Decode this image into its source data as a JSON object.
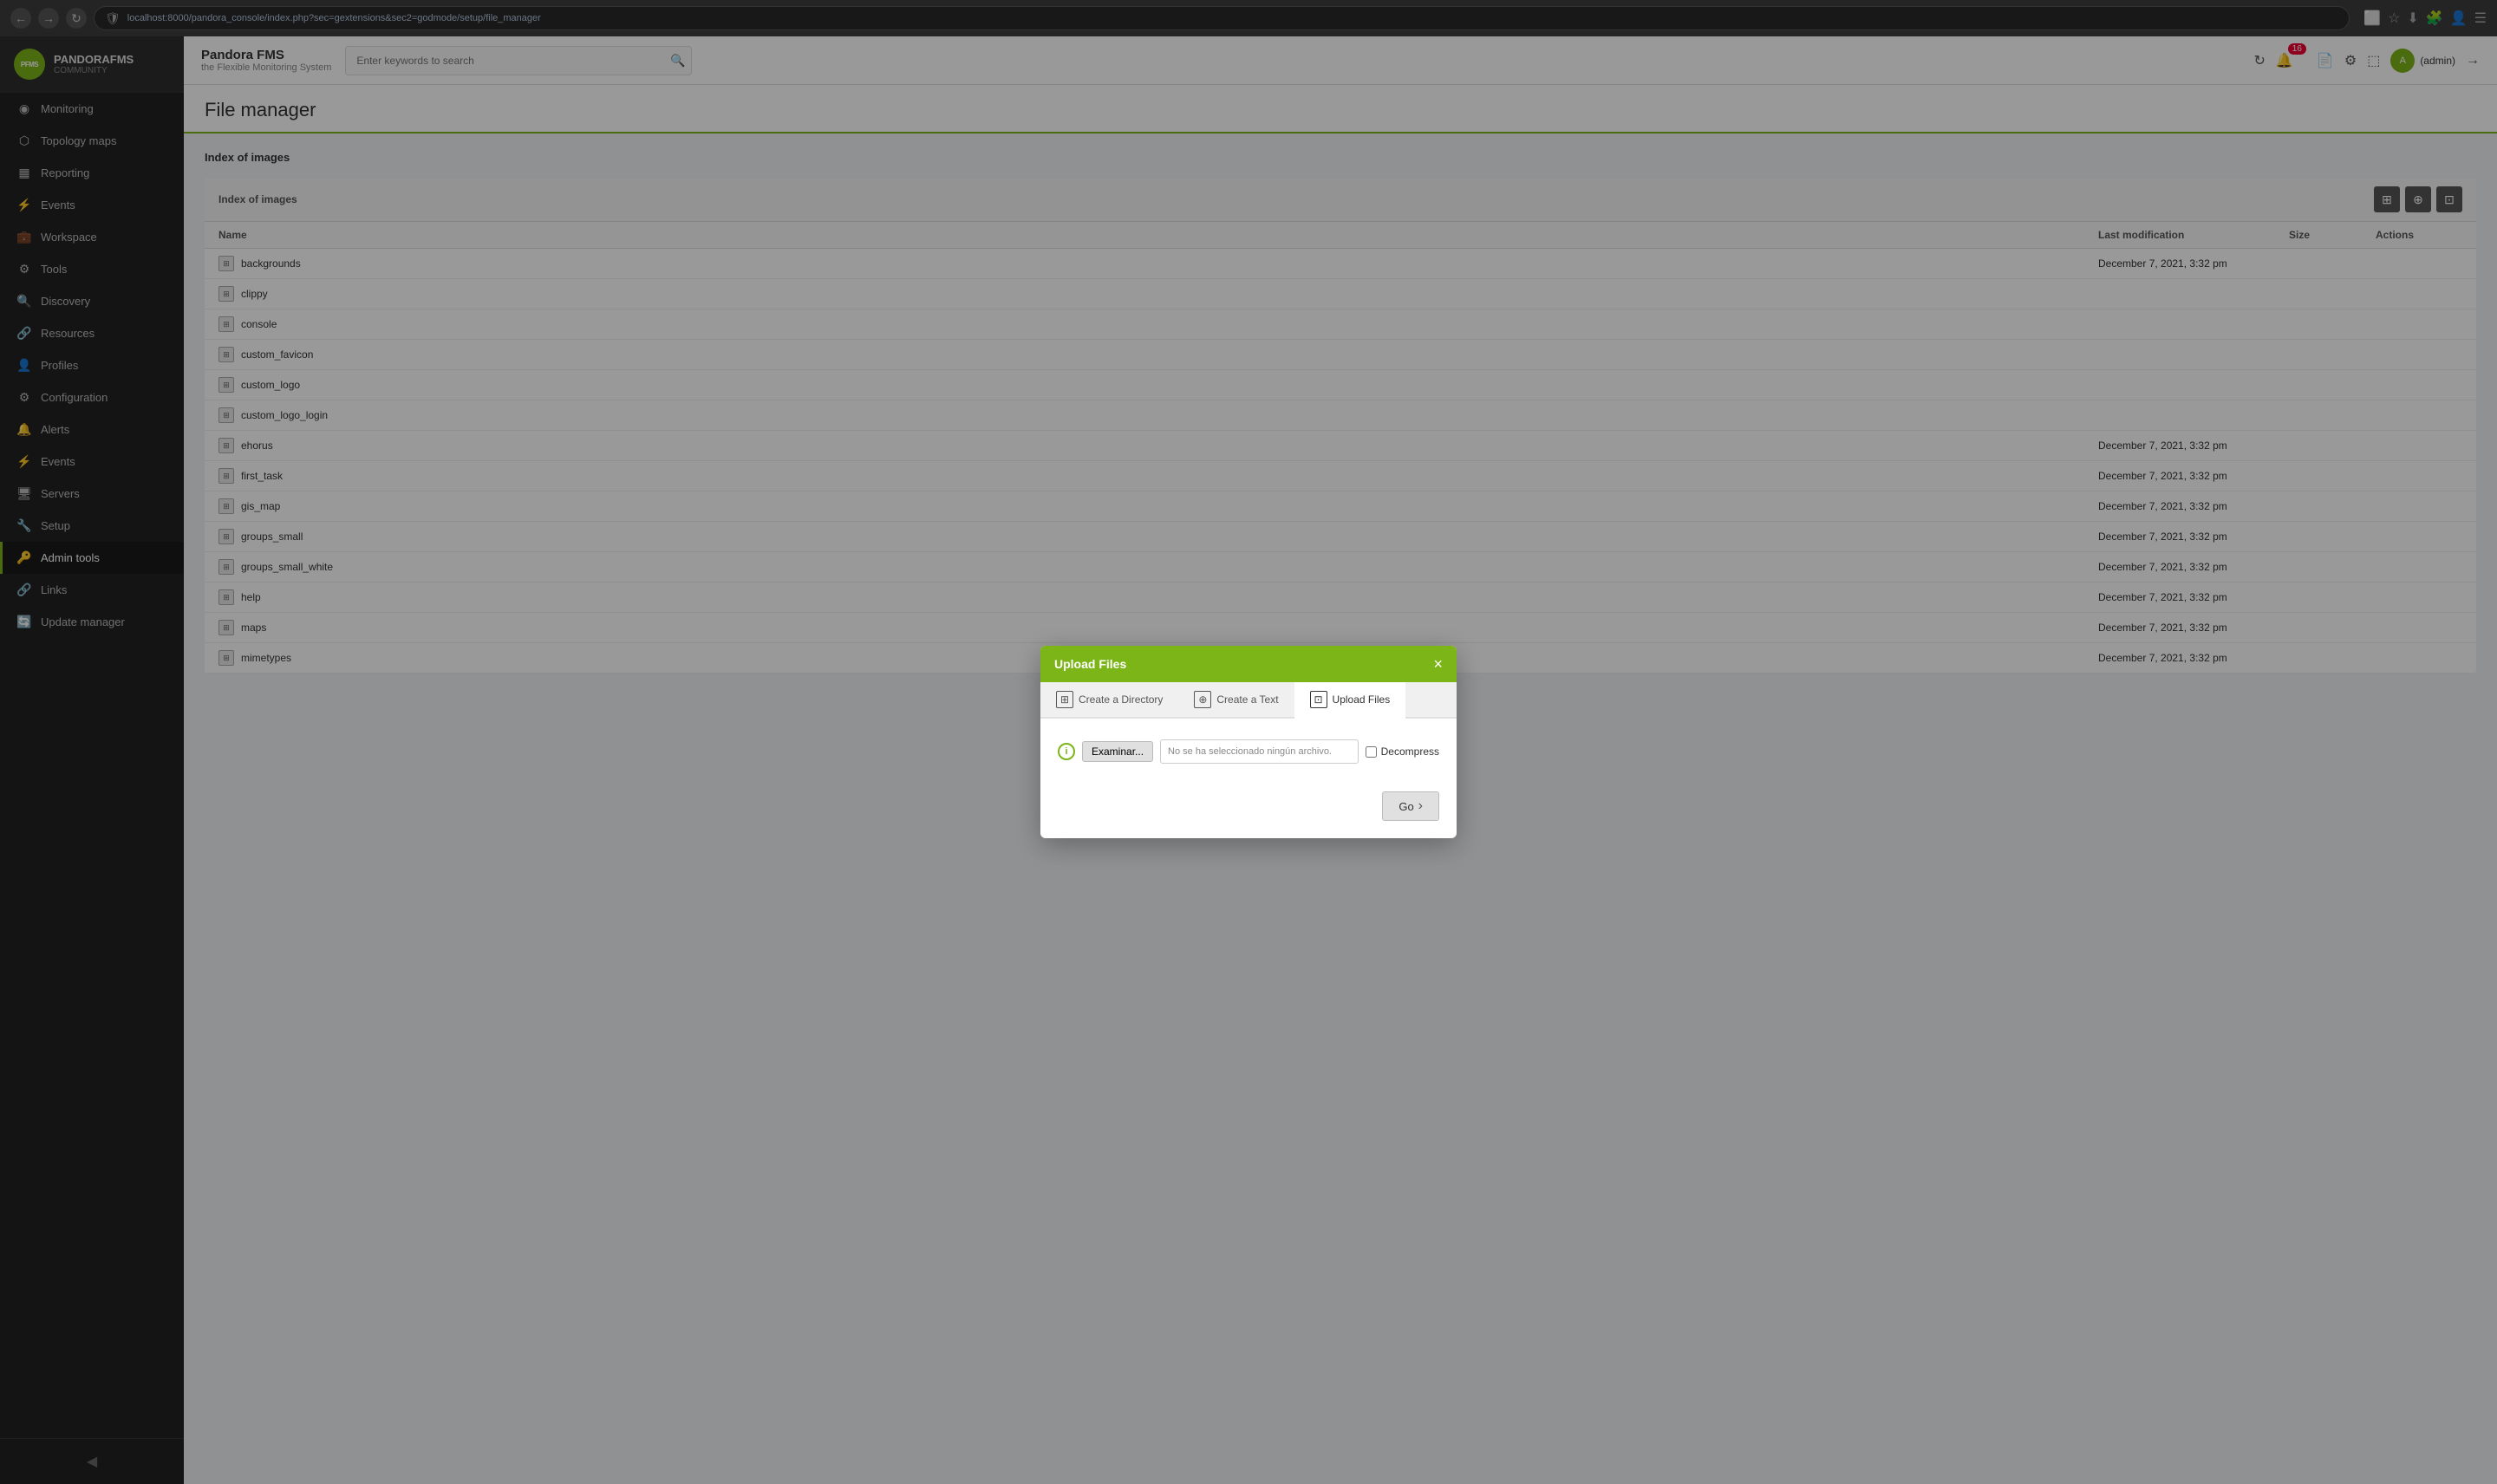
{
  "browser": {
    "url": "localhost:8000/pandora_console/index.php?sec=gextensions&sec2=godmode/setup/file_manager",
    "shield_icon": "🛡",
    "bookmark_icon": "☆",
    "tab_icon": "⬜",
    "download_icon": "⬇",
    "menu_icon": "☰"
  },
  "sidebar": {
    "logo": {
      "text": "PANDORAFMS",
      "subtitle": "COMMUNITY",
      "app_name": "Pandora FMS",
      "app_sub": "the Flexible Monitoring System"
    },
    "items": [
      {
        "id": "monitoring",
        "label": "Monitoring",
        "icon": "◉"
      },
      {
        "id": "topology-maps",
        "label": "Topology maps",
        "icon": "⬡"
      },
      {
        "id": "reporting",
        "label": "Reporting",
        "icon": "▦"
      },
      {
        "id": "events",
        "label": "Events",
        "icon": "⚡"
      },
      {
        "id": "workspace",
        "label": "Workspace",
        "icon": "💼"
      },
      {
        "id": "tools",
        "label": "Tools",
        "icon": "⚙"
      },
      {
        "id": "discovery",
        "label": "Discovery",
        "icon": "🔍"
      },
      {
        "id": "resources",
        "label": "Resources",
        "icon": "🔗"
      },
      {
        "id": "profiles",
        "label": "Profiles",
        "icon": "👤"
      },
      {
        "id": "configuration",
        "label": "Configuration",
        "icon": "⚙"
      },
      {
        "id": "alerts",
        "label": "Alerts",
        "icon": "🔔"
      },
      {
        "id": "events2",
        "label": "Events",
        "icon": "⚡"
      },
      {
        "id": "servers",
        "label": "Servers",
        "icon": "🖥"
      },
      {
        "id": "setup",
        "label": "Setup",
        "icon": "🔧"
      },
      {
        "id": "admin-tools",
        "label": "Admin tools",
        "icon": "🔑",
        "active": true
      },
      {
        "id": "links",
        "label": "Links",
        "icon": "🔗"
      },
      {
        "id": "update-manager",
        "label": "Update manager",
        "icon": "🔄"
      }
    ],
    "collapse_icon": "◀"
  },
  "header": {
    "app_name": "Pandora FMS",
    "app_subtitle": "the Flexible Monitoring System",
    "search_placeholder": "Enter keywords to search",
    "notif_count": "16",
    "user_label": "(admin)",
    "refresh_icon": "↻",
    "notif_icon": "🔔",
    "file_icon": "📄",
    "settings_icon": "⚙",
    "copy_icon": "⬚",
    "logout_icon": "→"
  },
  "page": {
    "title": "File manager",
    "breadcrumb": "Index of images"
  },
  "table": {
    "title": "Index of images",
    "columns": [
      "Name",
      "Last modification",
      "Size",
      "Actions"
    ],
    "rows": [
      {
        "name": "backgrounds",
        "modified": "December 7, 2021, 3:32 pm",
        "size": "",
        "actions": ""
      },
      {
        "name": "clippy",
        "modified": "",
        "size": "",
        "actions": ""
      },
      {
        "name": "console",
        "modified": "",
        "size": "",
        "actions": ""
      },
      {
        "name": "custom_favicon",
        "modified": "",
        "size": "",
        "actions": ""
      },
      {
        "name": "custom_logo",
        "modified": "",
        "size": "",
        "actions": ""
      },
      {
        "name": "custom_logo_login",
        "modified": "",
        "size": "",
        "actions": ""
      },
      {
        "name": "ehorus",
        "modified": "December 7, 2021, 3:32 pm",
        "size": "",
        "actions": ""
      },
      {
        "name": "first_task",
        "modified": "December 7, 2021, 3:32 pm",
        "size": "",
        "actions": ""
      },
      {
        "name": "gis_map",
        "modified": "December 7, 2021, 3:32 pm",
        "size": "",
        "actions": ""
      },
      {
        "name": "groups_small",
        "modified": "December 7, 2021, 3:32 pm",
        "size": "",
        "actions": ""
      },
      {
        "name": "groups_small_white",
        "modified": "December 7, 2021, 3:32 pm",
        "size": "",
        "actions": ""
      },
      {
        "name": "help",
        "modified": "December 7, 2021, 3:32 pm",
        "size": "",
        "actions": ""
      },
      {
        "name": "maps",
        "modified": "December 7, 2021, 3:32 pm",
        "size": "",
        "actions": ""
      },
      {
        "name": "mimetypes",
        "modified": "December 7, 2021, 3:32 pm",
        "size": "",
        "actions": ""
      }
    ],
    "icon_buttons": [
      "⊞",
      "⊕",
      "⊡"
    ]
  },
  "modal": {
    "title": "Upload Files",
    "close_label": "×",
    "tabs": [
      {
        "id": "create-directory",
        "label": "Create a Directory",
        "icon": "⊞",
        "active": false
      },
      {
        "id": "create-text",
        "label": "Create a Text",
        "icon": "⊕",
        "active": false
      },
      {
        "id": "upload-files",
        "label": "Upload Files",
        "icon": "⊡",
        "active": true
      }
    ],
    "file_choose_label": "Examinar...",
    "file_placeholder": "No se ha seleccionado ningún archivo.",
    "decompress_label": "Decompress",
    "go_label": "Go",
    "info_icon": "i"
  }
}
